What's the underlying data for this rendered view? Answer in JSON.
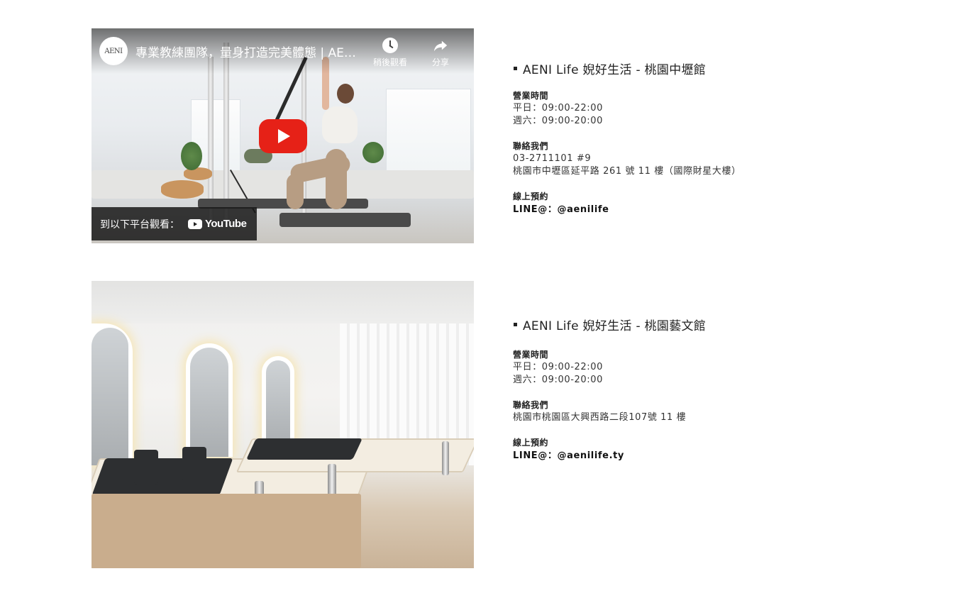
{
  "locations": [
    {
      "title": "AENI Life 婗好生活 - 桃園中壢館",
      "hours_label": "營業時間",
      "weekday_hours": "平日：09:00-22:00",
      "saturday_hours": "週六：09:00-20:00",
      "contact_label": "聯絡我們",
      "phone": "03-2711101 #9",
      "address": "桃園市中壢區延平路 261 號 11 樓（國際財星大樓）",
      "booking_label": "線上預約",
      "line_id": "LINE@：@aenilife"
    },
    {
      "title": "AENI Life 婗好生活 - 桃園藝文館",
      "hours_label": "營業時間",
      "weekday_hours": "平日：09:00-22:00",
      "saturday_hours": "週六：09:00-20:00",
      "contact_label": "聯絡我們",
      "address": "桃園市桃園區大興西路二段107號 11 樓",
      "booking_label": "線上預約",
      "line_id": "LINE@：@aenilife.ty"
    }
  ],
  "video": {
    "channel_logo_text": "AENI",
    "title": "專業教練團隊，量身打造完美體態 | AENI Life 婗好生活",
    "watch_later_label": "稍後觀看",
    "share_label": "分享",
    "watch_on_label": "到以下平台觀看：",
    "youtube_label": "YouTube",
    "play_button_color": "#e62117"
  },
  "icons": {
    "watch_later": "clock-icon",
    "share": "share-arrow-icon",
    "play": "play-icon",
    "youtube": "youtube-logo-icon"
  }
}
